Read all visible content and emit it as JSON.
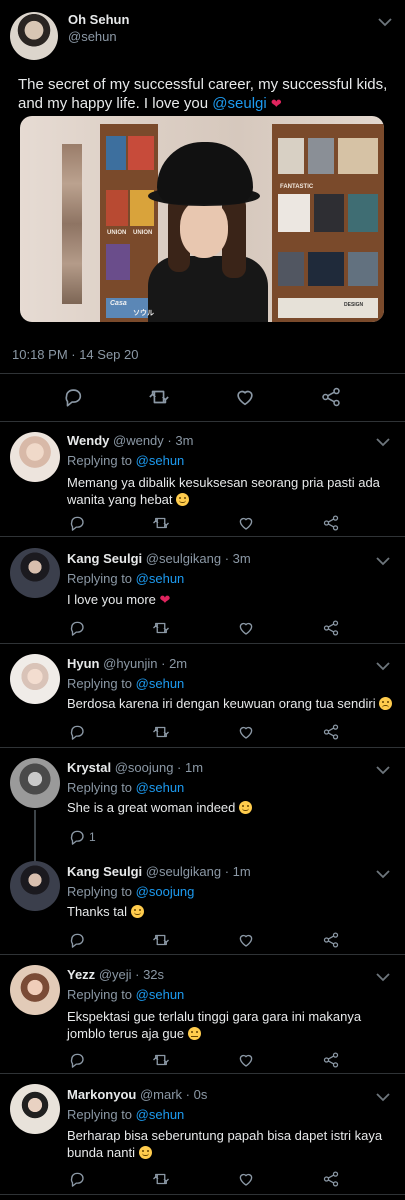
{
  "main_tweet": {
    "name": "Oh Sehun",
    "handle": "@sehun",
    "text_before": "The secret of my successful career, my successful kids, and my happy life. I love you ",
    "mention": "@seulgi",
    "heart": "❤",
    "timestamp": "10:18 PM · 14 Sep 20",
    "media_text": {
      "shelf_sign_1": "UNION",
      "shelf_sign_2": "UNION",
      "shelf_sign_3": "FANTASTIC",
      "shelf_sign_4": "Casa",
      "shelf_sign_5": "ソウル",
      "shelf_sign_6": "DESIGN"
    }
  },
  "replies": [
    {
      "name": "Wendy",
      "meta": "@wendy · 3m",
      "replying_prefix": "Replying to ",
      "replying_to": "@sehun",
      "text": "Memang ya dibalik kesuksesan seorang pria pasti ada wanita yang hebat",
      "emoji": "smile"
    },
    {
      "name": "Kang Seulgi",
      "meta": "@seulgikang · 3m",
      "replying_prefix": "Replying to ",
      "replying_to": "@sehun",
      "text": "I love you more",
      "emoji": "heart"
    },
    {
      "name": "Hyun",
      "meta": "@hyunjin · 2m",
      "replying_prefix": "Replying to ",
      "replying_to": "@sehun",
      "text": "Berdosa karena iri dengan keuwuan orang tua sendiri",
      "emoji": "pensive"
    },
    {
      "name": "Krystal",
      "meta": "@soojung · 1m",
      "replying_prefix": "Replying to ",
      "replying_to": "@sehun",
      "text": "She is a great woman indeed",
      "emoji": "slight-smile",
      "reply_count": "1"
    },
    {
      "name": "Kang Seulgi",
      "meta": "@seulgikang · 1m",
      "replying_prefix": "Replying to ",
      "replying_to": "@soojung",
      "text": "Thanks tal",
      "emoji": "smile"
    },
    {
      "name": "Yezz",
      "meta": "@yeji · 32s",
      "replying_prefix": "Replying to ",
      "replying_to": "@sehun",
      "text": "Ekspektasi gue terlalu tinggi gara gara ini makanya jomblo terus aja gue",
      "emoji": "neutral"
    },
    {
      "name": "Markonyou",
      "meta": "@mark · 0s",
      "replying_prefix": "Replying to ",
      "replying_to": "@sehun",
      "text": "Berharap bisa seberuntung papah bisa dapet istri kaya bunda nanti",
      "emoji": "smile"
    }
  ],
  "icons": {
    "reply": "reply-icon",
    "retweet": "retweet-icon",
    "like": "like-icon",
    "share": "share-icon",
    "more": "chevron-down-icon"
  },
  "colors": {
    "background": "#000000",
    "accent": "#1d9bf0",
    "muted": "#8b98a5",
    "heart": "#e0245e"
  }
}
